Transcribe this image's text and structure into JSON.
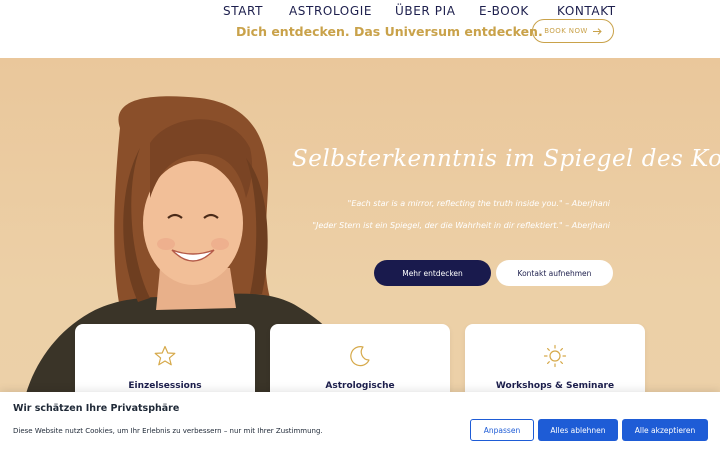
{
  "nav": {
    "items": [
      {
        "label": "START"
      },
      {
        "label": "ASTROLOGIE"
      },
      {
        "label": "ÜBER PIA"
      },
      {
        "label": "E-BOOK"
      },
      {
        "label": "KONTAKT"
      }
    ],
    "tagline": "Dich entdecken. Das Universum entdecken.",
    "book_label": "BOOK NOW"
  },
  "hero": {
    "title": "Selbsterkenntnis im Spiegel des Kosmos",
    "quote_en": "\"Each star is a mirror, reflecting the truth inside you.\" – Aberjhani",
    "quote_de": "\"Jeder Stern ist ein Spiegel, der die Wahrheit in dir reflektiert.\" – Aberjhani",
    "primary_button": "Mehr entdecken",
    "secondary_button": "Kontakt aufnehmen"
  },
  "cards": [
    {
      "title": "Einzelsessions",
      "icon": "star-icon"
    },
    {
      "title": "Astrologische",
      "icon": "moon-icon"
    },
    {
      "title": "Workshops & Seminare",
      "icon": "sun-icon"
    }
  ],
  "cookie": {
    "title": "Wir schätzen Ihre Privatsphäre",
    "text": "Diese Website nutzt Cookies, um Ihr Erlebnis zu verbessern – nur mit Ihrer Zustimmung.",
    "customize": "Anpassen",
    "deny": "Alles ablehnen",
    "accept": "Alle akzeptieren"
  },
  "colors": {
    "navy": "#191a4d",
    "gold": "#c9a24a",
    "beige": "#ebcb9f",
    "blue": "#1e5cd6"
  }
}
